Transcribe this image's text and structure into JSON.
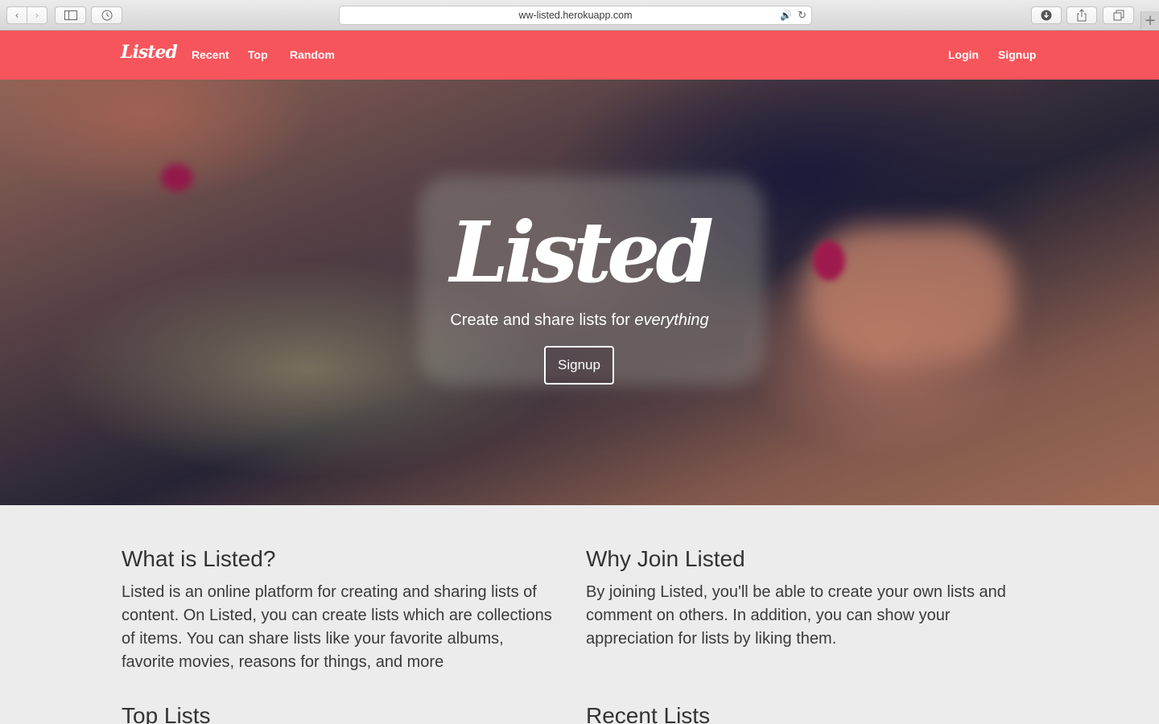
{
  "browser": {
    "url": "ww-listed.herokuapp.com",
    "back_icon": "chevron-left-icon",
    "forward_icon": "chevron-right-icon",
    "sidebar_icon": "sidebar-icon",
    "history_icon": "clock-icon",
    "download_icon": "download-icon",
    "share_icon": "share-icon",
    "tabs_icon": "tabs-icon",
    "new_tab": "+"
  },
  "nav": {
    "brand": "Listed",
    "links": [
      "Recent",
      "Top",
      "Random"
    ],
    "login": "Login",
    "signup": "Signup",
    "background": "#f7555c"
  },
  "hero": {
    "logo": "Listed",
    "tagline_prefix": "Create and share lists for ",
    "tagline_em": "everything",
    "button": "Signup"
  },
  "sections": {
    "what": {
      "title": "What is Listed?",
      "body": "Listed is an online platform for creating and sharing lists of content. On Listed, you can create lists which are collections of items. You can share lists like your favorite albums, favorite movies, reasons for things, and more"
    },
    "why": {
      "title": "Why Join Listed",
      "body": "By joining Listed, you'll be able to create your own lists and comment on others. In addition, you can show your appreciation for lists by liking them."
    },
    "top_lists": "Top Lists",
    "recent_lists": "Recent Lists"
  }
}
